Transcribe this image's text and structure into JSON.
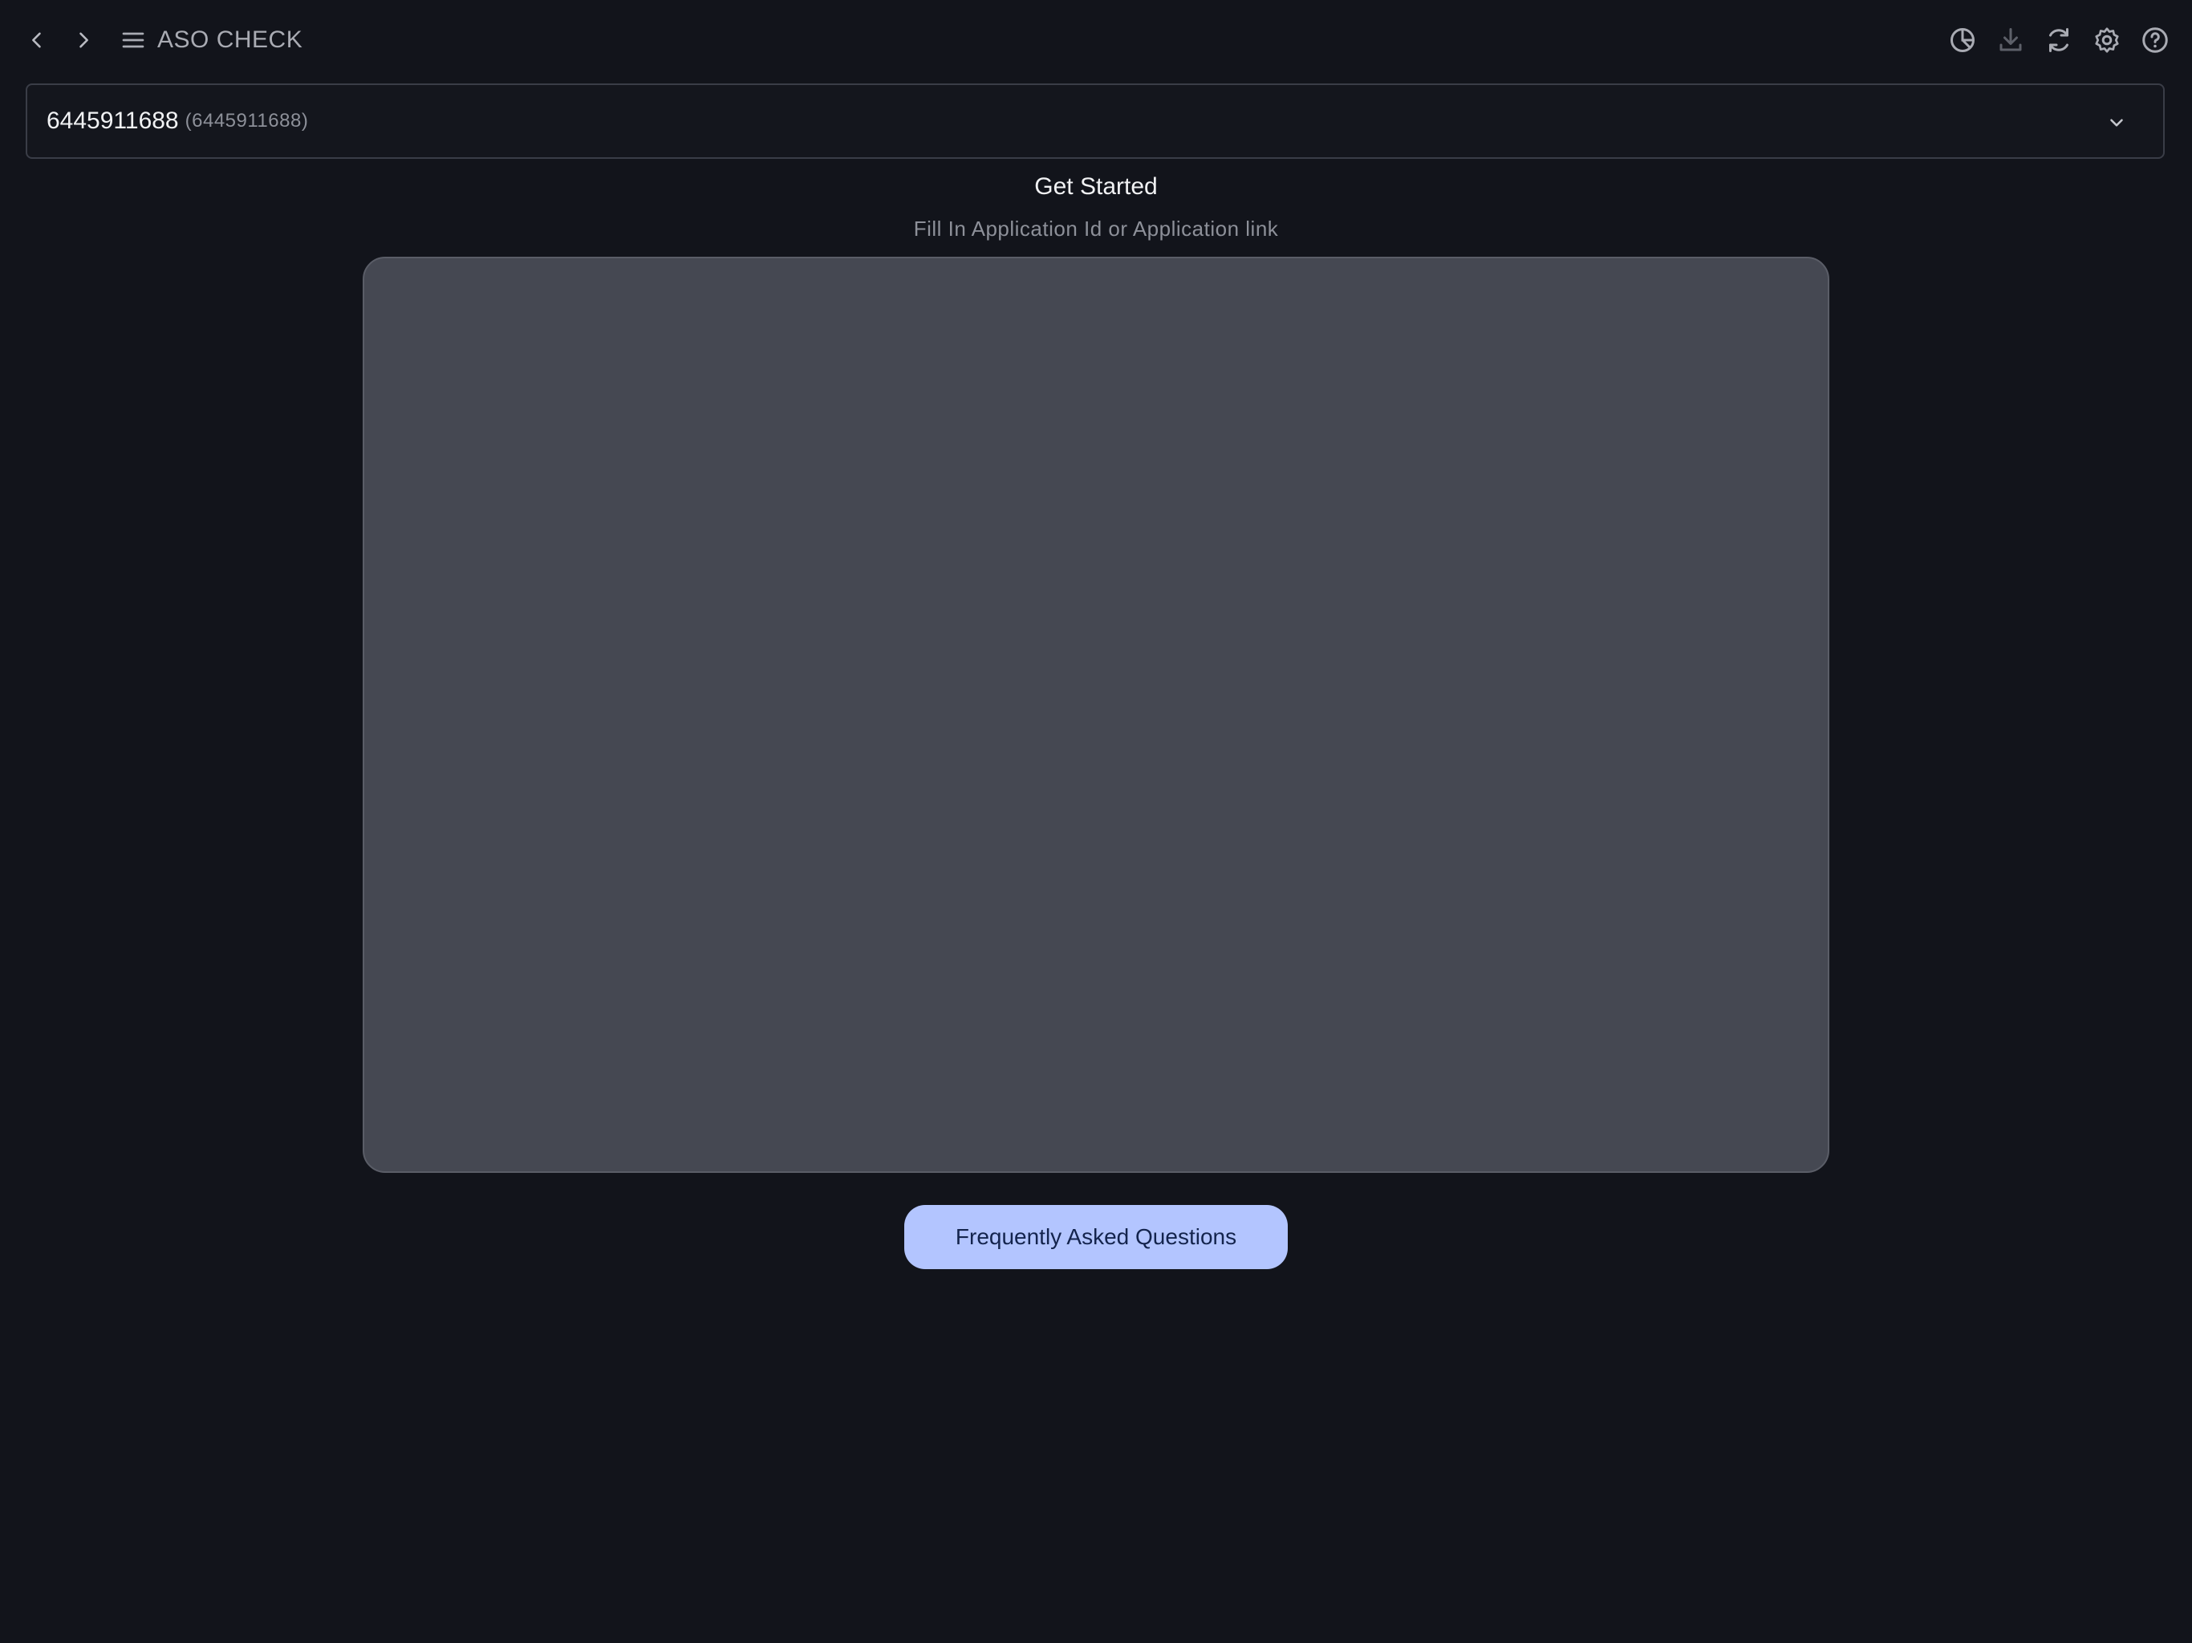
{
  "header": {
    "title": "ASO CHECK",
    "back_icon": "chevron-left-icon",
    "forward_icon": "chevron-right-icon",
    "menu_icon": "hamburger-menu-icon",
    "tools": [
      "chart-pie-icon",
      "download-icon",
      "refresh-icon",
      "gear-icon",
      "help-icon"
    ]
  },
  "app_select": {
    "value": "6445911688",
    "sub": "(6445911688)",
    "chevron_icon": "chevron-down-icon"
  },
  "main": {
    "heading": "Get Started",
    "subheading": "Fill In Application Id or Application link",
    "faq_label": "Frequently Asked Questions"
  },
  "colors": {
    "background": "#12141b",
    "panel": "#454852",
    "accent_button": "#b3c5ff",
    "accent_button_text": "#14244d"
  }
}
